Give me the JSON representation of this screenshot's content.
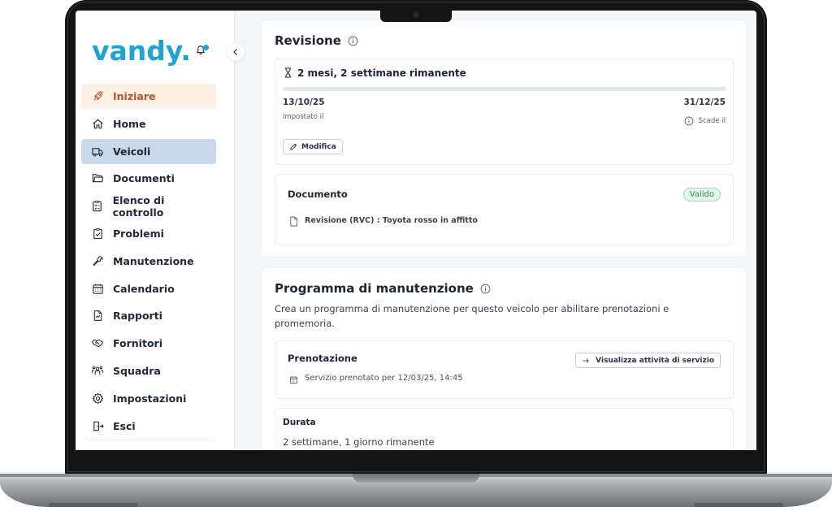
{
  "app": {
    "logo_text": "vandy.",
    "brand_color": "#1fa4cf",
    "notification_dot_color": "#1fa4cf"
  },
  "sidebar": {
    "items": [
      {
        "label": "Iniziare",
        "icon": "rocket-icon",
        "state": "highlight"
      },
      {
        "label": "Home",
        "icon": "home-icon",
        "state": "normal"
      },
      {
        "label": "Veicoli",
        "icon": "truck-icon",
        "state": "active"
      },
      {
        "label": "Documenti",
        "icon": "folder-icon",
        "state": "normal"
      },
      {
        "label": "Elenco di controllo",
        "icon": "checklist-icon",
        "state": "normal"
      },
      {
        "label": "Problemi",
        "icon": "clipboard-check-icon",
        "state": "normal"
      },
      {
        "label": "Manutenzione",
        "icon": "wrench-icon",
        "state": "normal"
      },
      {
        "label": "Calendario",
        "icon": "calendar-icon",
        "state": "normal"
      },
      {
        "label": "Rapporti",
        "icon": "report-icon",
        "state": "normal"
      },
      {
        "label": "Fornitori",
        "icon": "handshake-icon",
        "state": "normal"
      },
      {
        "label": "Squadra",
        "icon": "team-icon",
        "state": "normal"
      },
      {
        "label": "Impostazioni",
        "icon": "gear-icon",
        "state": "normal"
      },
      {
        "label": "Esci",
        "icon": "logout-icon",
        "state": "normal"
      }
    ]
  },
  "revisione": {
    "title": "Revisione",
    "remaining": "2 mesi, 2 settimane rimanente",
    "start_date": "13/10/25",
    "start_label": "Impostato il",
    "end_date": "31/12/25",
    "end_label": "Scade il",
    "progress_fraction": 0.0,
    "edit_label": "Modifica",
    "document": {
      "heading": "Documento",
      "status": "Valido",
      "name": "Revisione (RVC) : Toyota rosso in affitto"
    }
  },
  "programma": {
    "title": "Programma di manutenzione",
    "description_line1": "Crea un programma di manutenzione per questo veicolo per abilitare prenotazioni e",
    "description_line2": "promemoria.",
    "prenotazione": {
      "heading": "Prenotazione",
      "action_label": "Visualizza attività di servizio",
      "booked_text": "Servizio prenotato per 12/03/25, 14:45"
    },
    "durata": {
      "heading": "Durata",
      "value": "2 settimane, 1 giorno rimanente"
    }
  }
}
